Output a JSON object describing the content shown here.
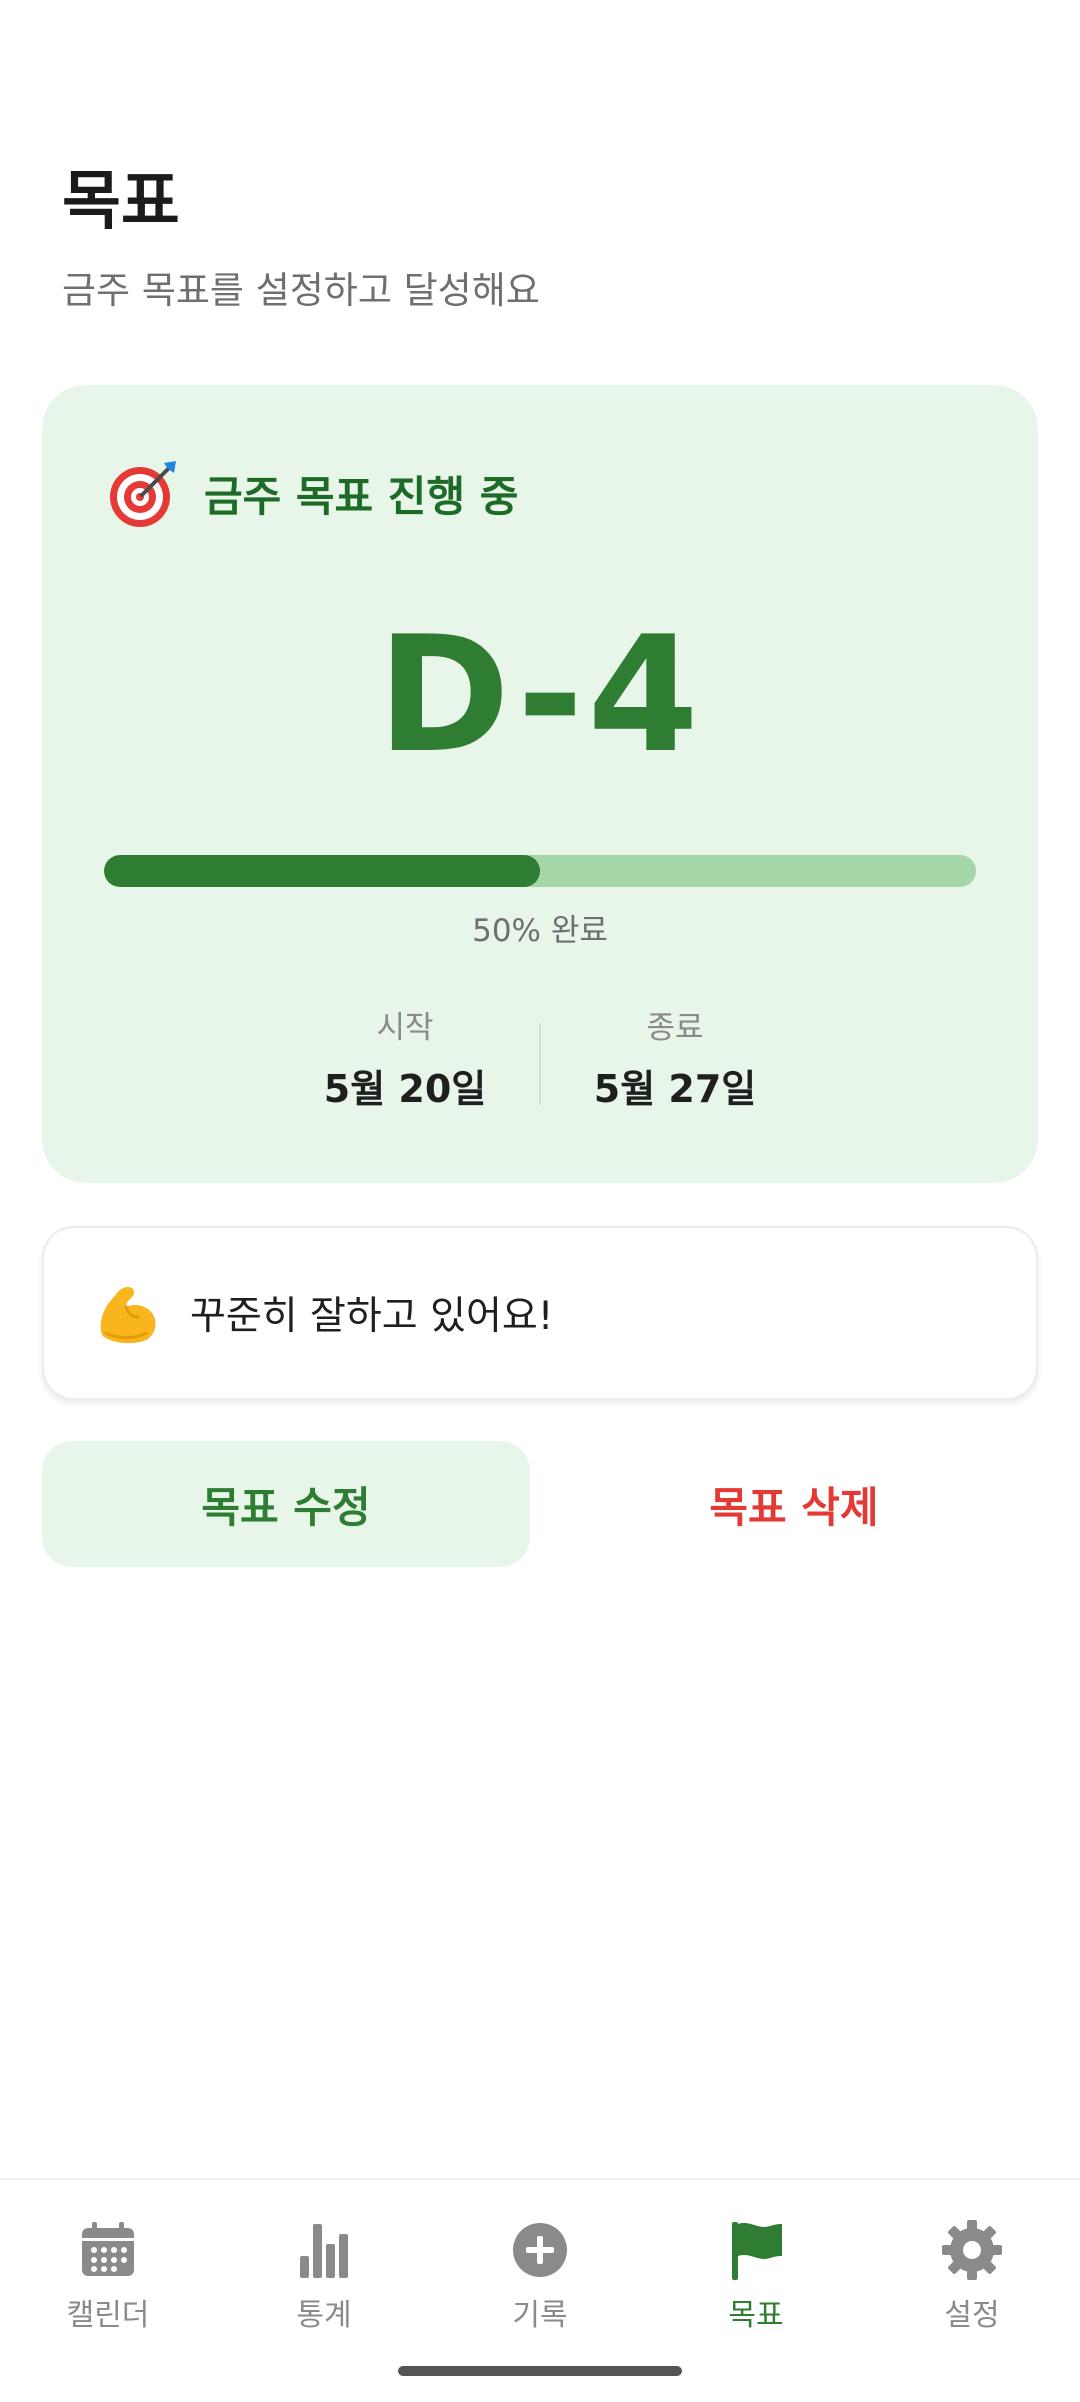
{
  "header": {
    "title": "목표",
    "subtitle": "금주 목표를 설정하고 달성해요"
  },
  "goal_card": {
    "icon": "target-icon",
    "status_title": "금주 목표 진행 중",
    "dday": "D-4",
    "progress_percent": 50,
    "progress_label": "50% 완료",
    "start_label": "시작",
    "start_date": "5월 20일",
    "end_label": "종료",
    "end_date": "5월 27일"
  },
  "cheer_card": {
    "icon": "flexed-biceps-icon",
    "message": "꾸준히 잘하고 있어요!"
  },
  "actions": {
    "edit_label": "목표 수정",
    "delete_label": "목표 삭제"
  },
  "bottom_nav": {
    "items": [
      {
        "label": "캘린더",
        "icon": "calendar-icon",
        "active": false
      },
      {
        "label": "통계",
        "icon": "bar-chart-icon",
        "active": false
      },
      {
        "label": "기록",
        "icon": "add-circle-icon",
        "active": false
      },
      {
        "label": "목표",
        "icon": "flag-icon",
        "active": true
      },
      {
        "label": "설정",
        "icon": "gear-icon",
        "active": false
      }
    ]
  },
  "colors": {
    "accent": "#2e7d32",
    "card_background": "#e8f5e9",
    "progress_track": "#a5d6a7",
    "danger": "#e53935"
  }
}
